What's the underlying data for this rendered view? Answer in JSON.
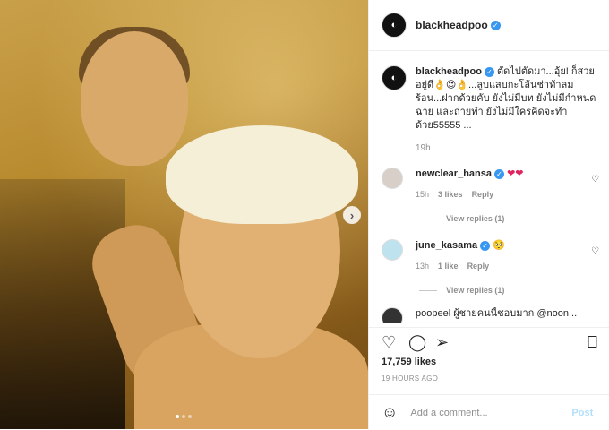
{
  "post": {
    "account": "blackheadpoo",
    "caption": "ตัดไปตัดมา...อุ้ย! ก็สวยอยู่ดี👌😍👌...ลูบแสบกะโล้นช่าท้าลมร้อน...ฝากด้วยคับ ยังไม่มีบท ยังไม่มีกำหนดฉาย และถ่ายทำ ยังไม่มีใครคิดจะทำด้วย55555 ...",
    "caption_time": "19h",
    "likes": "17,759 likes",
    "time_ago": "19 HOURS AGO"
  },
  "comments": [
    {
      "user": "newclear_hansa",
      "text": "❤❤",
      "time": "15h",
      "likes": "3 likes",
      "reply": "Reply",
      "replies": "View replies (1)"
    },
    {
      "user": "june_kasama",
      "text": "🥺",
      "time": "13h",
      "likes": "1 like",
      "reply": "Reply",
      "replies": "View replies (1)"
    }
  ],
  "partial_comment": "poopeel ผู้ชายคนนี้ชอบมาก @noon...",
  "add_comment": {
    "placeholder": "Add a comment...",
    "post": "Post"
  },
  "icons": {
    "like": "heart-icon",
    "comment": "comment-icon",
    "share": "share-icon",
    "save": "bookmark-icon",
    "emoji": "emoji-icon"
  }
}
